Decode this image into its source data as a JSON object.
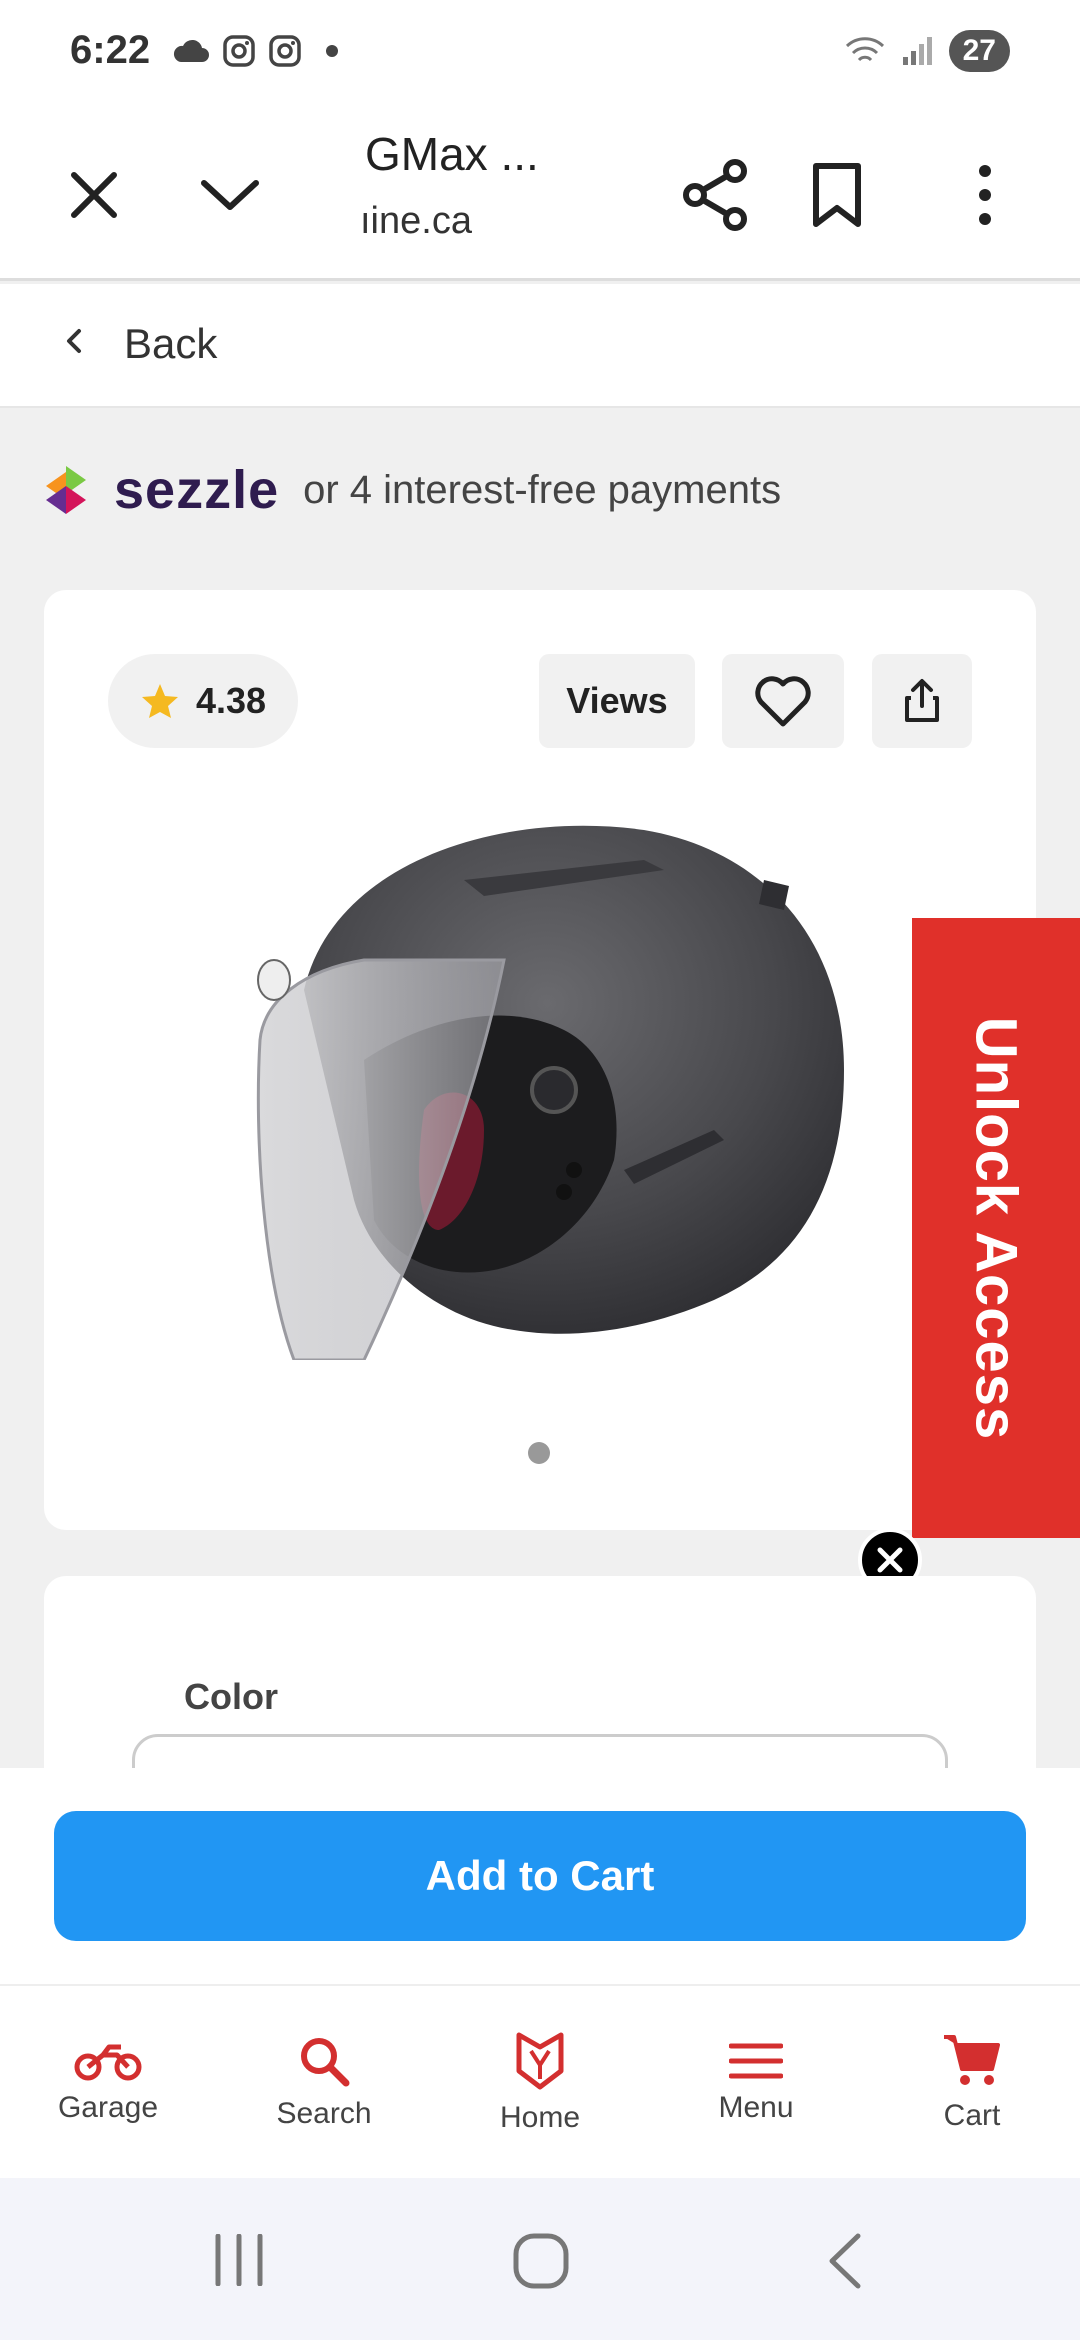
{
  "status_bar": {
    "time": "6:22",
    "battery": "27"
  },
  "tab_header": {
    "title": "GMax ...",
    "url": "ıine.ca"
  },
  "back": {
    "label": "Back"
  },
  "sezzle": {
    "brand": "sezzle",
    "text": "or 4 interest-free payments"
  },
  "product": {
    "rating": "4.38",
    "views_label": "Views",
    "image_count": 1,
    "image_index": 1
  },
  "unlock": {
    "label": "Unlock Access"
  },
  "options": {
    "color_label": "Color"
  },
  "cart": {
    "add_label": "Add to Cart"
  },
  "bottom_nav": {
    "items": [
      {
        "label": "Garage",
        "icon": "motorcycle-icon"
      },
      {
        "label": "Search",
        "icon": "search-icon"
      },
      {
        "label": "Home",
        "icon": "home-logo-icon"
      },
      {
        "label": "Menu",
        "icon": "menu-icon"
      },
      {
        "label": "Cart",
        "icon": "cart-icon"
      }
    ]
  },
  "colors": {
    "accent_red": "#e0302a",
    "add_to_cart_blue": "#2196f3",
    "nav_icon_red": "#d32f2f",
    "star": "#f5b921"
  }
}
